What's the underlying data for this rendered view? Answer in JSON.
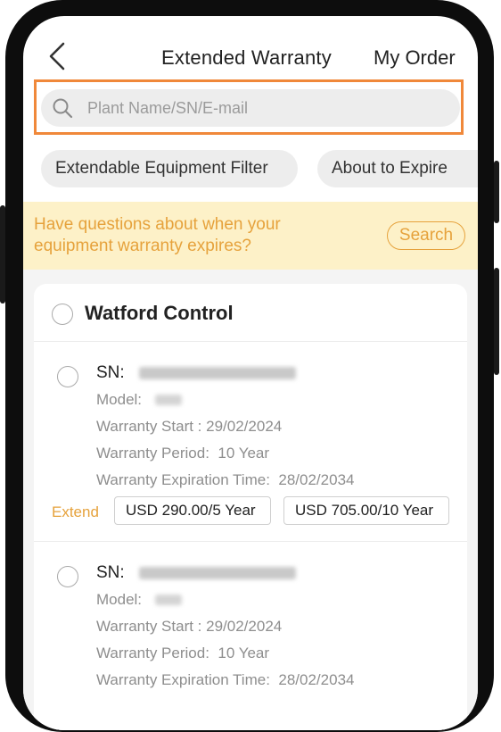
{
  "header": {
    "title": "Extended Warranty",
    "my_order_label": "My Order"
  },
  "search": {
    "placeholder": "Plant Name/SN/E-mail",
    "highlight_color": "#f0883a"
  },
  "filters": [
    {
      "label": "Extendable Equipment Filter"
    },
    {
      "label": "About to Expire"
    }
  ],
  "banner": {
    "text": "Have questions about when your equipment warranty expires?",
    "button_label": "Search",
    "accent_color": "#e6a23c"
  },
  "group": {
    "name": "Watford Control"
  },
  "labels": {
    "sn": "SN:",
    "model": "Model:",
    "warranty_start": "Warranty Start :",
    "warranty_period": "Warranty Period:",
    "warranty_expiration": "Warranty Expiration Time:",
    "extend": "Extend"
  },
  "devices": [
    {
      "warranty_start": "29/02/2024",
      "warranty_period": "10 Year",
      "warranty_expiration": "28/02/2034",
      "options": [
        "USD 290.00/5 Year",
        "USD 705.00/10 Year"
      ]
    },
    {
      "warranty_start": "29/02/2024",
      "warranty_period": "10 Year",
      "warranty_expiration": "28/02/2034"
    }
  ],
  "icons": {
    "back": "back-arrow-icon",
    "search": "search-icon"
  }
}
